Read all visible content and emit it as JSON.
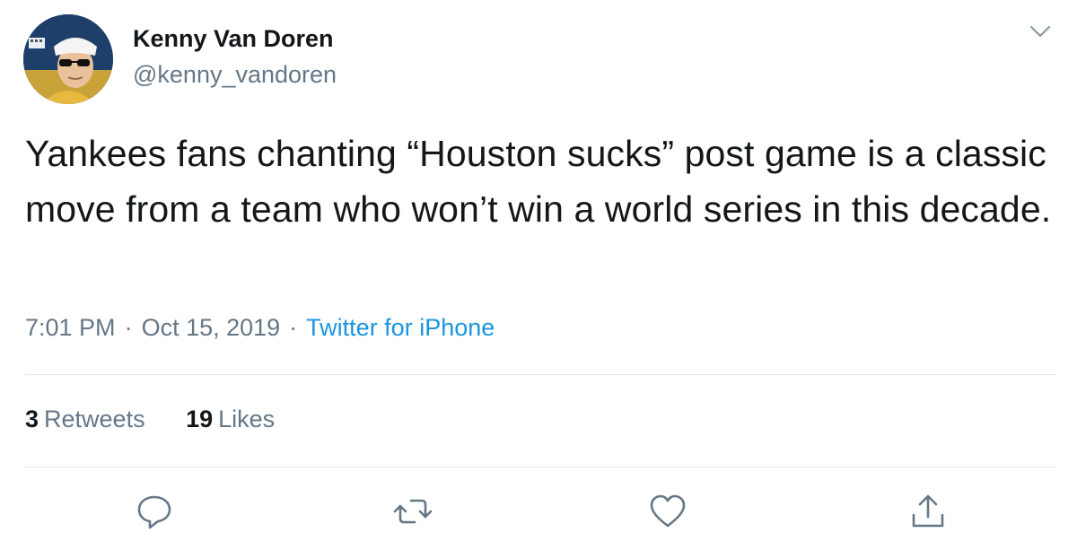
{
  "author": {
    "display_name": "Kenny Van Doren",
    "handle": "@kenny_vandoren"
  },
  "tweet": {
    "text": "Yankees fans chanting “Houston sucks” post game is a classic move from a team who won’t win a world series in this decade.",
    "time": "7:01 PM",
    "date": "Oct 15, 2019",
    "separator": "·",
    "source": "Twitter for iPhone"
  },
  "stats": {
    "retweets_count": "3",
    "retweets_label": "Retweets",
    "likes_count": "19",
    "likes_label": "Likes"
  },
  "icons": {
    "menu": "chevron-down-icon",
    "reply": "reply-icon",
    "retweet": "retweet-icon",
    "like": "heart-icon",
    "share": "share-icon"
  },
  "colors": {
    "text": "#14171a",
    "secondary": "#657786",
    "link": "#1b95e0",
    "divider": "#e1e8ed"
  }
}
